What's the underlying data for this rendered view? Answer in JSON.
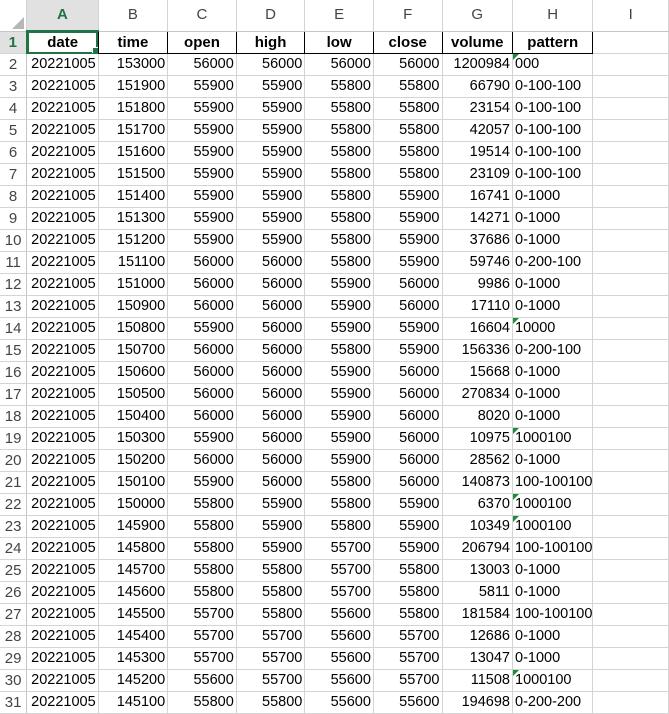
{
  "columns": [
    "A",
    "B",
    "C",
    "D",
    "E",
    "F",
    "G",
    "H",
    "I"
  ],
  "headers": [
    "date",
    "time",
    "open",
    "high",
    "low",
    "close",
    "volume",
    "pattern"
  ],
  "rows": [
    {
      "n": "2",
      "date": "20221005",
      "time": "153000",
      "open": "56000",
      "high": "56000",
      "low": "56000",
      "close": "56000",
      "volume": "1200984",
      "pattern": "000",
      "warn": true
    },
    {
      "n": "3",
      "date": "20221005",
      "time": "151900",
      "open": "55900",
      "high": "55900",
      "low": "55800",
      "close": "55800",
      "volume": "66790",
      "pattern": "0-100-100",
      "warn": false
    },
    {
      "n": "4",
      "date": "20221005",
      "time": "151800",
      "open": "55900",
      "high": "55900",
      "low": "55800",
      "close": "55800",
      "volume": "23154",
      "pattern": "0-100-100",
      "warn": false
    },
    {
      "n": "5",
      "date": "20221005",
      "time": "151700",
      "open": "55900",
      "high": "55900",
      "low": "55800",
      "close": "55800",
      "volume": "42057",
      "pattern": "0-100-100",
      "warn": false
    },
    {
      "n": "6",
      "date": "20221005",
      "time": "151600",
      "open": "55900",
      "high": "55900",
      "low": "55800",
      "close": "55800",
      "volume": "19514",
      "pattern": "0-100-100",
      "warn": false
    },
    {
      "n": "7",
      "date": "20221005",
      "time": "151500",
      "open": "55900",
      "high": "55900",
      "low": "55800",
      "close": "55800",
      "volume": "23109",
      "pattern": "0-100-100",
      "warn": false
    },
    {
      "n": "8",
      "date": "20221005",
      "time": "151400",
      "open": "55900",
      "high": "55900",
      "low": "55800",
      "close": "55900",
      "volume": "16741",
      "pattern": "0-1000",
      "warn": false
    },
    {
      "n": "9",
      "date": "20221005",
      "time": "151300",
      "open": "55900",
      "high": "55900",
      "low": "55800",
      "close": "55900",
      "volume": "14271",
      "pattern": "0-1000",
      "warn": false
    },
    {
      "n": "10",
      "date": "20221005",
      "time": "151200",
      "open": "55900",
      "high": "55900",
      "low": "55800",
      "close": "55900",
      "volume": "37686",
      "pattern": "0-1000",
      "warn": false
    },
    {
      "n": "11",
      "date": "20221005",
      "time": "151100",
      "open": "56000",
      "high": "56000",
      "low": "55800",
      "close": "55900",
      "volume": "59746",
      "pattern": "0-200-100",
      "warn": false
    },
    {
      "n": "12",
      "date": "20221005",
      "time": "151000",
      "open": "56000",
      "high": "56000",
      "low": "55900",
      "close": "56000",
      "volume": "9986",
      "pattern": "0-1000",
      "warn": false
    },
    {
      "n": "13",
      "date": "20221005",
      "time": "150900",
      "open": "56000",
      "high": "56000",
      "low": "55900",
      "close": "56000",
      "volume": "17110",
      "pattern": "0-1000",
      "warn": false
    },
    {
      "n": "14",
      "date": "20221005",
      "time": "150800",
      "open": "55900",
      "high": "56000",
      "low": "55900",
      "close": "55900",
      "volume": "16604",
      "pattern": "10000",
      "warn": true
    },
    {
      "n": "15",
      "date": "20221005",
      "time": "150700",
      "open": "56000",
      "high": "56000",
      "low": "55800",
      "close": "55900",
      "volume": "156336",
      "pattern": "0-200-100",
      "warn": false
    },
    {
      "n": "16",
      "date": "20221005",
      "time": "150600",
      "open": "56000",
      "high": "56000",
      "low": "55900",
      "close": "56000",
      "volume": "15668",
      "pattern": "0-1000",
      "warn": false
    },
    {
      "n": "17",
      "date": "20221005",
      "time": "150500",
      "open": "56000",
      "high": "56000",
      "low": "55900",
      "close": "56000",
      "volume": "270834",
      "pattern": "0-1000",
      "warn": false
    },
    {
      "n": "18",
      "date": "20221005",
      "time": "150400",
      "open": "56000",
      "high": "56000",
      "low": "55900",
      "close": "56000",
      "volume": "8020",
      "pattern": "0-1000",
      "warn": false
    },
    {
      "n": "19",
      "date": "20221005",
      "time": "150300",
      "open": "55900",
      "high": "56000",
      "low": "55900",
      "close": "56000",
      "volume": "10975",
      "pattern": "1000100",
      "warn": true
    },
    {
      "n": "20",
      "date": "20221005",
      "time": "150200",
      "open": "56000",
      "high": "56000",
      "low": "55900",
      "close": "56000",
      "volume": "28562",
      "pattern": "0-1000",
      "warn": false
    },
    {
      "n": "21",
      "date": "20221005",
      "time": "150100",
      "open": "55900",
      "high": "56000",
      "low": "55800",
      "close": "56000",
      "volume": "140873",
      "pattern": "100-100100",
      "warn": false
    },
    {
      "n": "22",
      "date": "20221005",
      "time": "150000",
      "open": "55800",
      "high": "55900",
      "low": "55800",
      "close": "55900",
      "volume": "6370",
      "pattern": "1000100",
      "warn": true
    },
    {
      "n": "23",
      "date": "20221005",
      "time": "145900",
      "open": "55800",
      "high": "55900",
      "low": "55800",
      "close": "55900",
      "volume": "10349",
      "pattern": "1000100",
      "warn": true
    },
    {
      "n": "24",
      "date": "20221005",
      "time": "145800",
      "open": "55800",
      "high": "55900",
      "low": "55700",
      "close": "55900",
      "volume": "206794",
      "pattern": "100-100100",
      "warn": false
    },
    {
      "n": "25",
      "date": "20221005",
      "time": "145700",
      "open": "55800",
      "high": "55800",
      "low": "55700",
      "close": "55800",
      "volume": "13003",
      "pattern": "0-1000",
      "warn": false
    },
    {
      "n": "26",
      "date": "20221005",
      "time": "145600",
      "open": "55800",
      "high": "55800",
      "low": "55700",
      "close": "55800",
      "volume": "5811",
      "pattern": "0-1000",
      "warn": false
    },
    {
      "n": "27",
      "date": "20221005",
      "time": "145500",
      "open": "55700",
      "high": "55800",
      "low": "55600",
      "close": "55800",
      "volume": "181584",
      "pattern": "100-100100",
      "warn": false
    },
    {
      "n": "28",
      "date": "20221005",
      "time": "145400",
      "open": "55700",
      "high": "55700",
      "low": "55600",
      "close": "55700",
      "volume": "12686",
      "pattern": "0-1000",
      "warn": false
    },
    {
      "n": "29",
      "date": "20221005",
      "time": "145300",
      "open": "55700",
      "high": "55700",
      "low": "55600",
      "close": "55700",
      "volume": "13047",
      "pattern": "0-1000",
      "warn": false
    },
    {
      "n": "30",
      "date": "20221005",
      "time": "145200",
      "open": "55600",
      "high": "55700",
      "low": "55600",
      "close": "55700",
      "volume": "11508",
      "pattern": "1000100",
      "warn": true
    },
    {
      "n": "31",
      "date": "20221005",
      "time": "145100",
      "open": "55800",
      "high": "55800",
      "low": "55600",
      "close": "55600",
      "volume": "194698",
      "pattern": "0-200-200",
      "warn": false
    }
  ],
  "colors": {
    "accent": "#217346",
    "warning_marker": "#1e8a3c",
    "gridline": "#d4d4d4"
  },
  "icons": {
    "select_all": "select-all-triangle-icon",
    "text_number_warning": "green-triangle-warning-icon",
    "fill_handle": "fill-handle-icon"
  }
}
